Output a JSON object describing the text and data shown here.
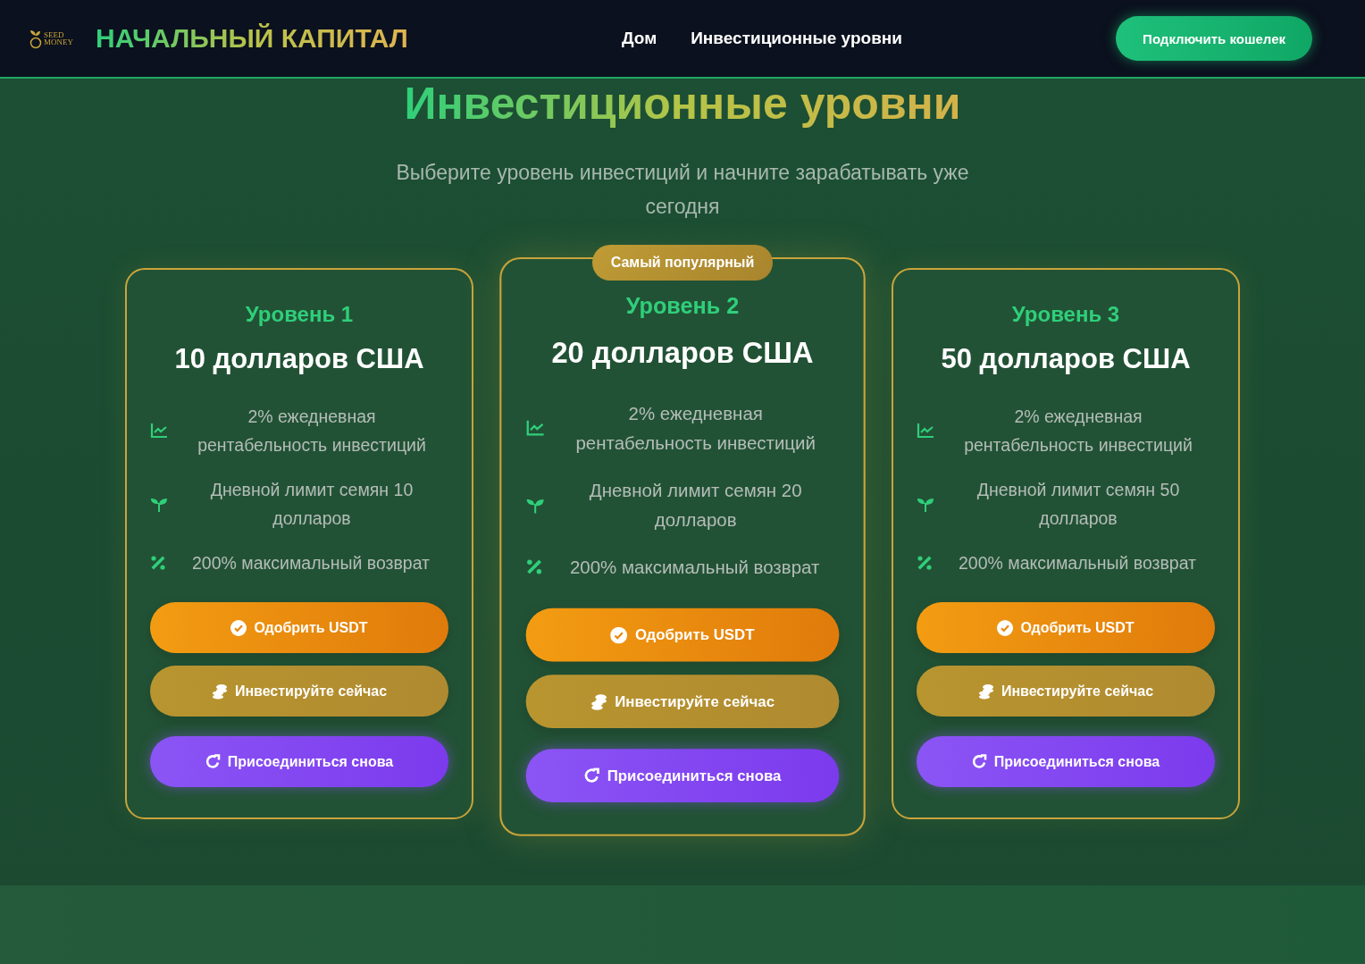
{
  "header": {
    "logo_text": [
      "SEED",
      "MONEY"
    ],
    "brand": "НАЧАЛЬНЫЙ КАПИТАЛ",
    "nav": [
      {
        "label": "Дом"
      },
      {
        "label": "Инвестиционные уровни"
      }
    ],
    "connect_button": "Подключить кошелек"
  },
  "hero": {
    "title": "Инвестиционные уровни",
    "subtitle": "Выберите уровень инвестиций и начните зарабатывать уже сегодня"
  },
  "tiers": [
    {
      "featured": false,
      "level": "Уровень 1",
      "price": "10 долларов США",
      "features": [
        {
          "kind": "chart",
          "text": "2% ежедневная рентабельность инвестиций"
        },
        {
          "kind": "sprout",
          "text": "Дневной лимит семян 10 долларов"
        },
        {
          "kind": "percent",
          "text": "200% максимальный возврат"
        }
      ],
      "buttons": [
        {
          "kind": "approve",
          "label": "Одобрить USDT"
        },
        {
          "kind": "invest",
          "label": "Инвестируйте сейчас"
        },
        {
          "kind": "rejoin",
          "label": "Присоединиться снова"
        }
      ]
    },
    {
      "featured": true,
      "badge": "Самый популярный",
      "level": "Уровень 2",
      "price": "20 долларов США",
      "features": [
        {
          "kind": "chart",
          "text": "2% ежедневная рентабельность инвестиций"
        },
        {
          "kind": "sprout",
          "text": "Дневной лимит семян 20 долларов"
        },
        {
          "kind": "percent",
          "text": "200% максимальный возврат"
        }
      ],
      "buttons": [
        {
          "kind": "approve",
          "label": "Одобрить USDT"
        },
        {
          "kind": "invest",
          "label": "Инвестируйте сейчас"
        },
        {
          "kind": "rejoin",
          "label": "Присоединиться снова"
        }
      ]
    },
    {
      "featured": false,
      "level": "Уровень 3",
      "price": "50 долларов США",
      "features": [
        {
          "kind": "chart",
          "text": "2% ежедневная рентабельность инвестиций"
        },
        {
          "kind": "sprout",
          "text": "Дневной лимит семян 50 долларов"
        },
        {
          "kind": "percent",
          "text": "200% максимальный возврат"
        }
      ],
      "buttons": [
        {
          "kind": "approve",
          "label": "Одобрить USDT"
        },
        {
          "kind": "invest",
          "label": "Инвестируйте сейчас"
        },
        {
          "kind": "rejoin",
          "label": "Присоединиться снова"
        }
      ]
    }
  ]
}
